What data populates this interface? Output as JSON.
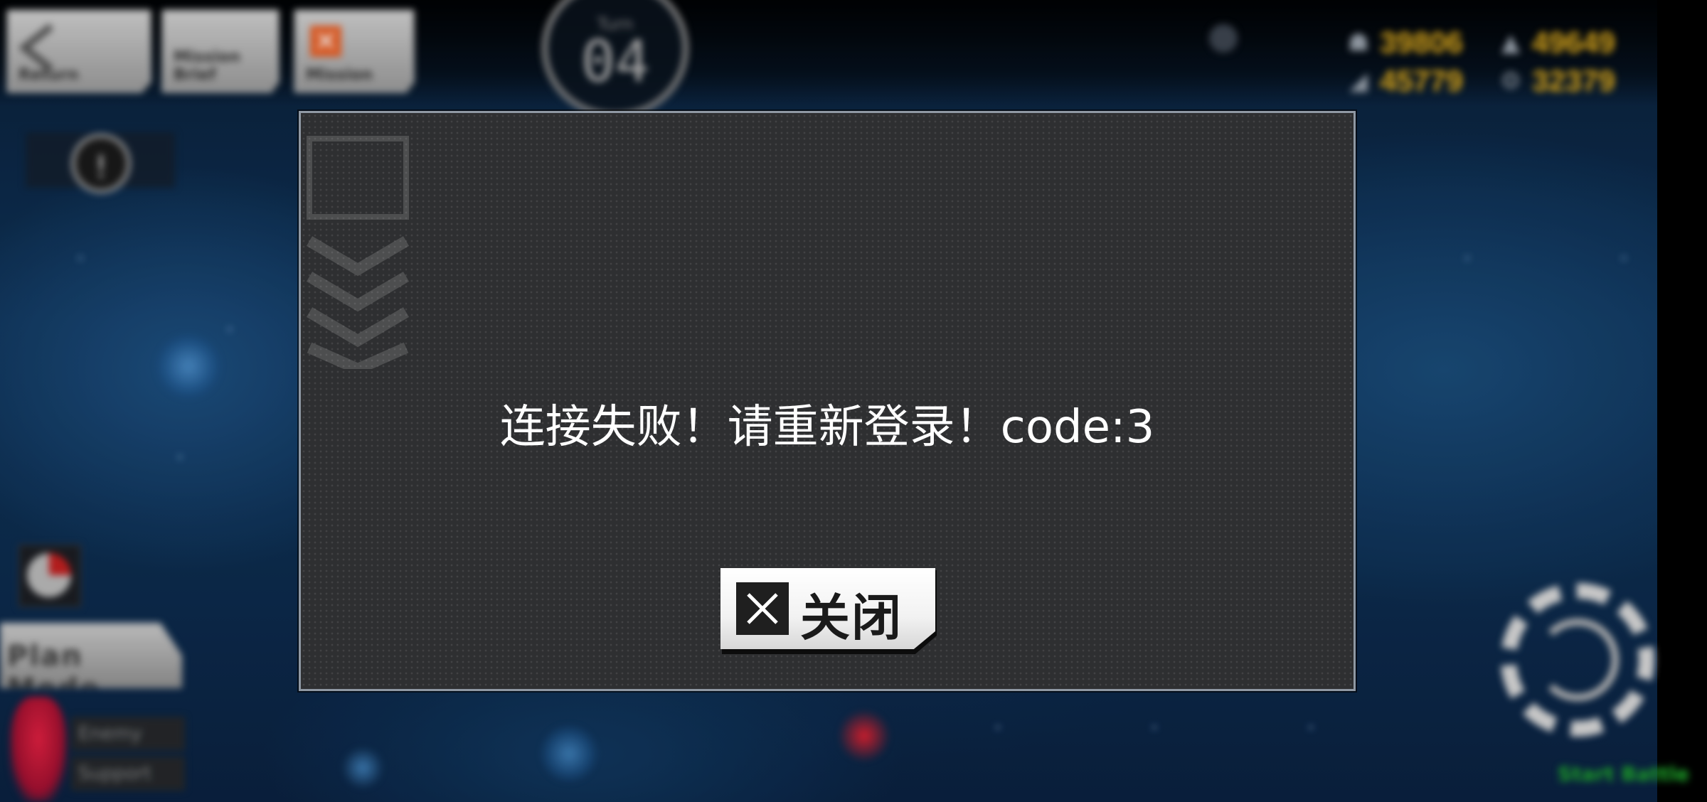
{
  "hud": {
    "back_button": {
      "label": "Return"
    },
    "button2": {
      "label": "Mission Brief"
    },
    "mission_button": {
      "label": "Mission"
    },
    "turn_label": "Turn",
    "turn_number": "04",
    "resources": {
      "manpower": "39806",
      "ammo": "49649",
      "rations": "45779",
      "parts": "32379"
    },
    "mode_button": {
      "label": "Plan Mode"
    },
    "tags": [
      "Enemy",
      "Support"
    ],
    "bottom_right_label": "Start Battle",
    "colors": {
      "resource_text": "#e8b21c",
      "green_label": "#1fae2b",
      "alert_red": "#c02020"
    }
  },
  "dialog": {
    "message": "连接失败！请重新登录！code:3",
    "close_button": {
      "label": "关闭",
      "icon": "close-icon"
    }
  }
}
